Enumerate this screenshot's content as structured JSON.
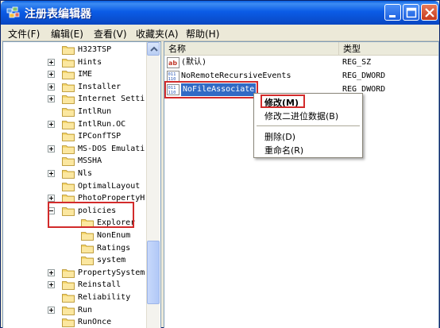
{
  "window": {
    "title": "注册表编辑器"
  },
  "menu": [
    "文件(F)",
    "编辑(E)",
    "查看(V)",
    "收藏夹(A)",
    "帮助(H)"
  ],
  "tree": {
    "items": [
      {
        "label": "H323TSP",
        "level": 1,
        "expander": "none"
      },
      {
        "label": "Hints",
        "level": 1,
        "expander": "plus"
      },
      {
        "label": "IME",
        "level": 1,
        "expander": "plus"
      },
      {
        "label": "Installer",
        "level": 1,
        "expander": "plus"
      },
      {
        "label": "Internet Setti",
        "level": 1,
        "expander": "plus"
      },
      {
        "label": "IntlRun",
        "level": 1,
        "expander": "none"
      },
      {
        "label": "IntlRun.OC",
        "level": 1,
        "expander": "plus"
      },
      {
        "label": "IPConfTSP",
        "level": 1,
        "expander": "none"
      },
      {
        "label": "MS-DOS Emulati",
        "level": 1,
        "expander": "plus"
      },
      {
        "label": "MSSHA",
        "level": 1,
        "expander": "none"
      },
      {
        "label": "Nls",
        "level": 1,
        "expander": "plus"
      },
      {
        "label": "OptimalLayout",
        "level": 1,
        "expander": "none"
      },
      {
        "label": "PhotoPropertyH",
        "level": 1,
        "expander": "plus"
      },
      {
        "label": "policies",
        "level": 1,
        "expander": "minus"
      },
      {
        "label": "Explorer",
        "level": 2,
        "expander": "none"
      },
      {
        "label": "NonEnum",
        "level": 2,
        "expander": "none"
      },
      {
        "label": "Ratings",
        "level": 2,
        "expander": "none"
      },
      {
        "label": "system",
        "level": 2,
        "expander": "none"
      },
      {
        "label": "PropertySystem",
        "level": 1,
        "expander": "plus"
      },
      {
        "label": "Reinstall",
        "level": 1,
        "expander": "plus"
      },
      {
        "label": "Reliability",
        "level": 1,
        "expander": "none"
      },
      {
        "label": "Run",
        "level": 1,
        "expander": "plus"
      },
      {
        "label": "RunOnce",
        "level": 1,
        "expander": "none"
      }
    ]
  },
  "list": {
    "columns": {
      "name": "名称",
      "type": "类型"
    },
    "rows": [
      {
        "name": "(默认)",
        "type": "REG_SZ",
        "icon": "string-value-icon"
      },
      {
        "name": "NoRemoteRecursiveEvents",
        "type": "REG_DWORD",
        "icon": "dword-value-icon"
      },
      {
        "name": "NoFileAssociate",
        "type": "REG_DWORD",
        "icon": "dword-value-icon"
      }
    ]
  },
  "context_menu": {
    "items": [
      "修改(M)",
      "修改二进位数据(B)",
      "删除(D)",
      "重命名(R)"
    ]
  },
  "colors": {
    "title_bar": "#0a5fe0",
    "selection": "#316ac5",
    "highlight_box": "#d22b2b",
    "folder": "#f5d66b"
  }
}
